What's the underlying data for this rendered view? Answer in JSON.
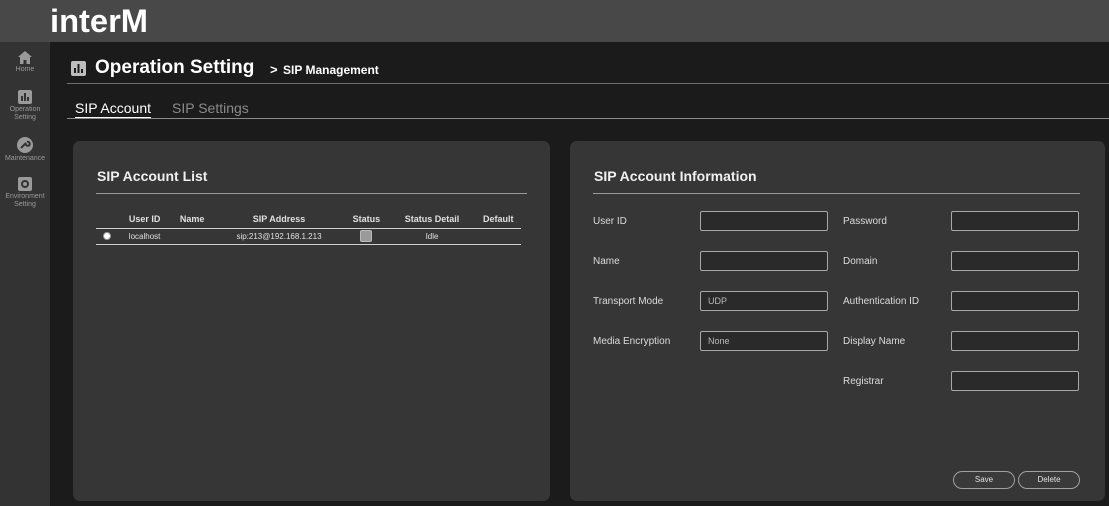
{
  "brand": {
    "logo_text": "interM"
  },
  "sidebar": {
    "items": [
      {
        "label": "Home",
        "icon": "home-icon"
      },
      {
        "label": "Operation\nSetting",
        "icon": "chart-icon"
      },
      {
        "label": "Maintenance",
        "icon": "wrench-icon"
      },
      {
        "label": "Environment\nSetting",
        "icon": "settings-icon"
      }
    ]
  },
  "header": {
    "title": "Operation Setting",
    "separator": ">",
    "subtitle": "SIP Management"
  },
  "tabs": [
    {
      "label": "SIP Account",
      "active": true
    },
    {
      "label": "SIP Settings",
      "active": false
    }
  ],
  "account_list": {
    "title": "SIP Account List",
    "columns": [
      "",
      "User ID",
      "Name",
      "SIP Address",
      "Status",
      "Status Detail",
      "Default"
    ],
    "rows": [
      {
        "user_id": "localhost",
        "name": "",
        "sip_address": "sip:213@192.168.1.213",
        "status": "",
        "status_detail": "Idle",
        "default": ""
      }
    ]
  },
  "account_info": {
    "title": "SIP Account Information",
    "fields": {
      "user_id": {
        "label": "User ID",
        "value": ""
      },
      "password": {
        "label": "Password",
        "value": ""
      },
      "name": {
        "label": "Name",
        "value": ""
      },
      "domain": {
        "label": "Domain",
        "value": ""
      },
      "transport_mode": {
        "label": "Transport Mode",
        "value": "UDP"
      },
      "authentication_id": {
        "label": "Authentication ID",
        "value": ""
      },
      "media_encryption": {
        "label": "Media Encryption",
        "value": "None"
      },
      "display_name": {
        "label": "Display Name",
        "value": ""
      },
      "registrar": {
        "label": "Registrar",
        "value": ""
      }
    },
    "buttons": {
      "save": "Save",
      "delete": "Delete"
    }
  },
  "colors": {
    "topbar": "#484848",
    "sidebar": "#333333",
    "panel": "#363636",
    "background": "#1b1b1b"
  }
}
